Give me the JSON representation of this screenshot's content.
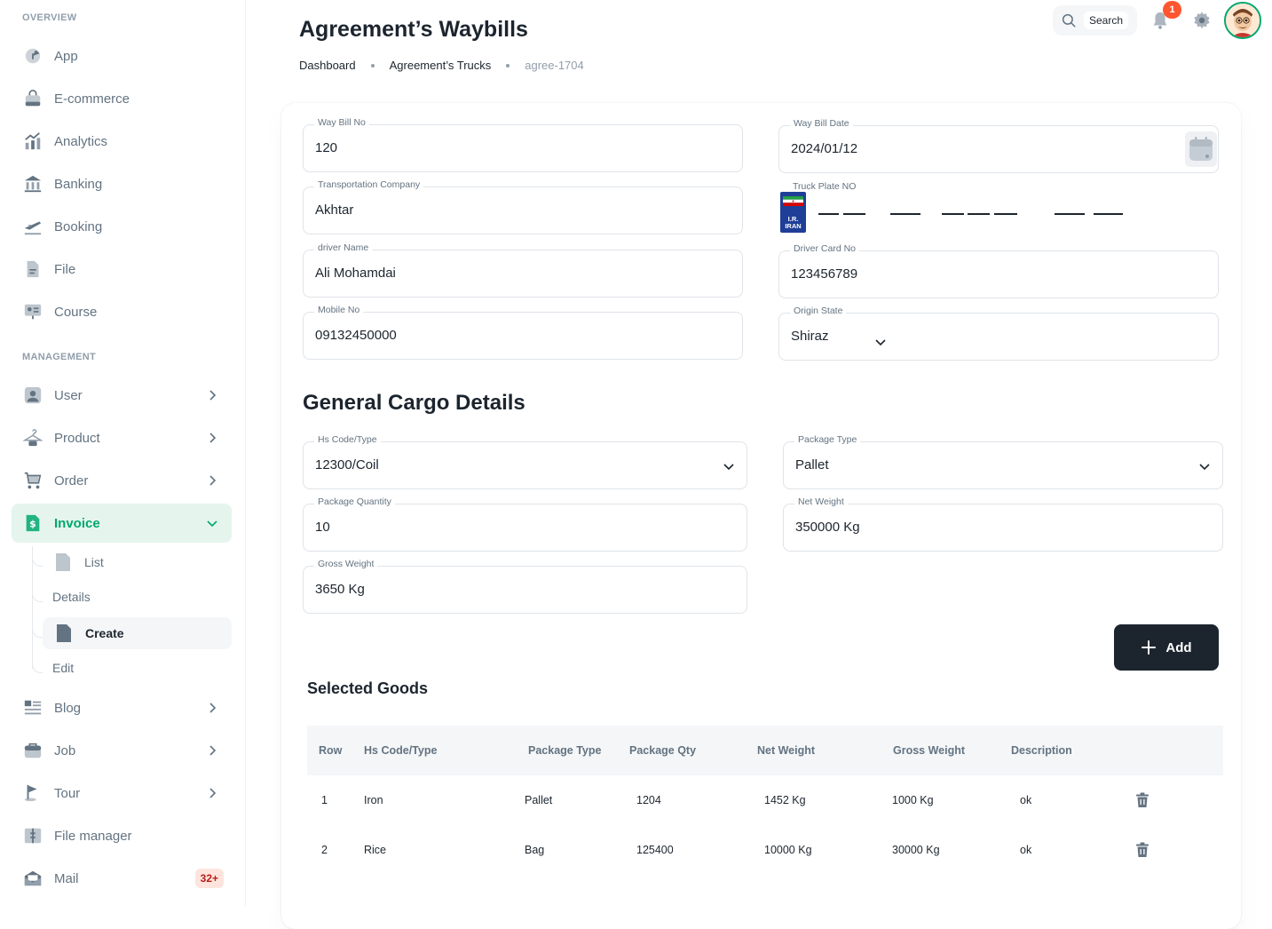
{
  "sidebar": {
    "overview_label": "OVERVIEW",
    "management_label": "MANAGEMENT",
    "items": [
      {
        "label": "App",
        "icon": "app-icon"
      },
      {
        "label": "E-commerce",
        "icon": "shopping-bag-icon"
      },
      {
        "label": "Analytics",
        "icon": "analytics-icon"
      },
      {
        "label": "Banking",
        "icon": "bank-icon"
      },
      {
        "label": "Booking",
        "icon": "airplane-icon"
      },
      {
        "label": "File",
        "icon": "file-icon"
      },
      {
        "label": "Course",
        "icon": "course-icon"
      },
      {
        "label": "User",
        "icon": "user-icon"
      },
      {
        "label": "Product",
        "icon": "hanger-icon"
      },
      {
        "label": "Order",
        "icon": "cart-icon"
      },
      {
        "label": "Invoice",
        "icon": "invoice-icon"
      },
      {
        "label": "Blog",
        "icon": "blog-icon"
      },
      {
        "label": "Job",
        "icon": "briefcase-icon"
      },
      {
        "label": "Tour",
        "icon": "flag-icon"
      },
      {
        "label": "File manager",
        "icon": "folder-icon"
      },
      {
        "label": "Mail",
        "icon": "mail-icon",
        "badge": "32+"
      }
    ],
    "invoice_sub": [
      "List",
      "Details",
      "Create",
      "Edit"
    ]
  },
  "header": {
    "search_label": "Search",
    "notification_count": "1",
    "title": "Agreement’s  Waybills",
    "breadcrumb": [
      "Dashboard",
      "Agreement’s Trucks",
      "agree-1704"
    ]
  },
  "form": {
    "way_bill_no": {
      "label": "Way Bill No",
      "value": "120"
    },
    "way_bill_date": {
      "label": "Way Bill Date",
      "value": "2024/01/12"
    },
    "transport_company": {
      "label": "Transportation Company",
      "value": "Akhtar"
    },
    "truck_plate": {
      "label": "Truck Plate NO",
      "flag_text": "I.R.",
      "flag_text2": "IRAN"
    },
    "driver_name": {
      "label": "driver Name",
      "value": "Ali Mohamdai"
    },
    "driver_card": {
      "label": "Driver Card No",
      "value": "123456789"
    },
    "mobile_no": {
      "label": "Mobile No",
      "value": "09132450000"
    },
    "origin_state": {
      "label": "Origin State",
      "value": "Shiraz"
    }
  },
  "cargo": {
    "title": "General Cargo Details",
    "hs_code": {
      "label": "Hs Code/Type",
      "value": "12300/Coil"
    },
    "package_type": {
      "label": "Package Type",
      "value": "Pallet"
    },
    "package_qty": {
      "label": "Package Quantity",
      "value": "10"
    },
    "net_weight": {
      "label": "Net Weight",
      "value": "350000 Kg"
    },
    "gross_weight": {
      "label": "Gross Weight",
      "value": "3650 Kg"
    },
    "add_label": "Add"
  },
  "goods": {
    "title": "Selected Goods",
    "columns": [
      "Row",
      "Hs Code/Type",
      "Package Type",
      "Package Qty",
      "Net Weight",
      "Gross Weight",
      "Description"
    ],
    "rows": [
      [
        "1",
        "Iron",
        "Pallet",
        "1204",
        "1452 Kg",
        "1000 Kg",
        "ok"
      ],
      [
        "2",
        "Rice",
        "Bag",
        "125400",
        "10000 Kg",
        "30000 Kg",
        "ok"
      ]
    ]
  },
  "colors": {
    "accent": "#00A76F",
    "dark": "#1C252E",
    "muted": "#637381"
  }
}
